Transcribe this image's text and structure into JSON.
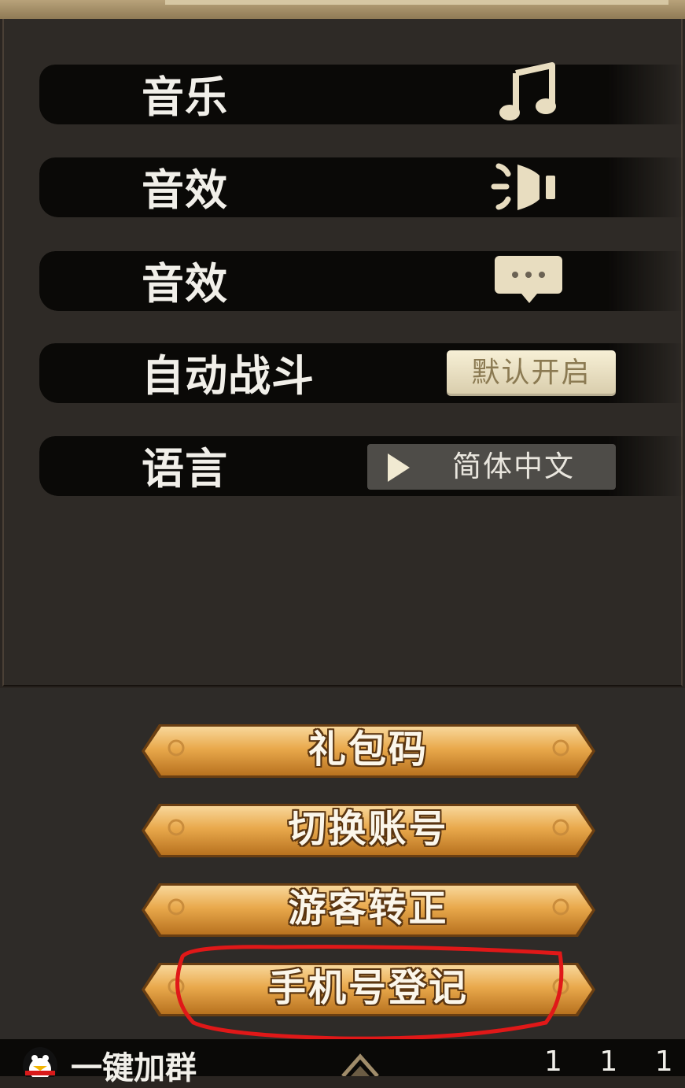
{
  "settings": {
    "rows": [
      {
        "label": "音乐",
        "control": "music-note-icon"
      },
      {
        "label": "音效",
        "control": "speaker-icon"
      },
      {
        "label": "音效",
        "control": "chat-bubble-icon"
      },
      {
        "label": "自动战斗",
        "control_label": "默认开启"
      },
      {
        "label": "语言",
        "control_label": "简体中文",
        "control_icon": "play-arrow-icon"
      }
    ]
  },
  "buttons": {
    "gift_code": "礼包码",
    "switch_account": "切换账号",
    "guest_upgrade": "游客转正",
    "phone_register": "手机号登记"
  },
  "bottom_bar": {
    "group_label": "一键加群",
    "avatar_icon": "qq-penguin-icon",
    "right_text": "1 1 1"
  },
  "colors": {
    "panel_bg": "#2e2a26",
    "brush": "#0a0907",
    "cream": "#e8ddc0",
    "gold": "#e0a048",
    "highlight": "#e01818"
  }
}
